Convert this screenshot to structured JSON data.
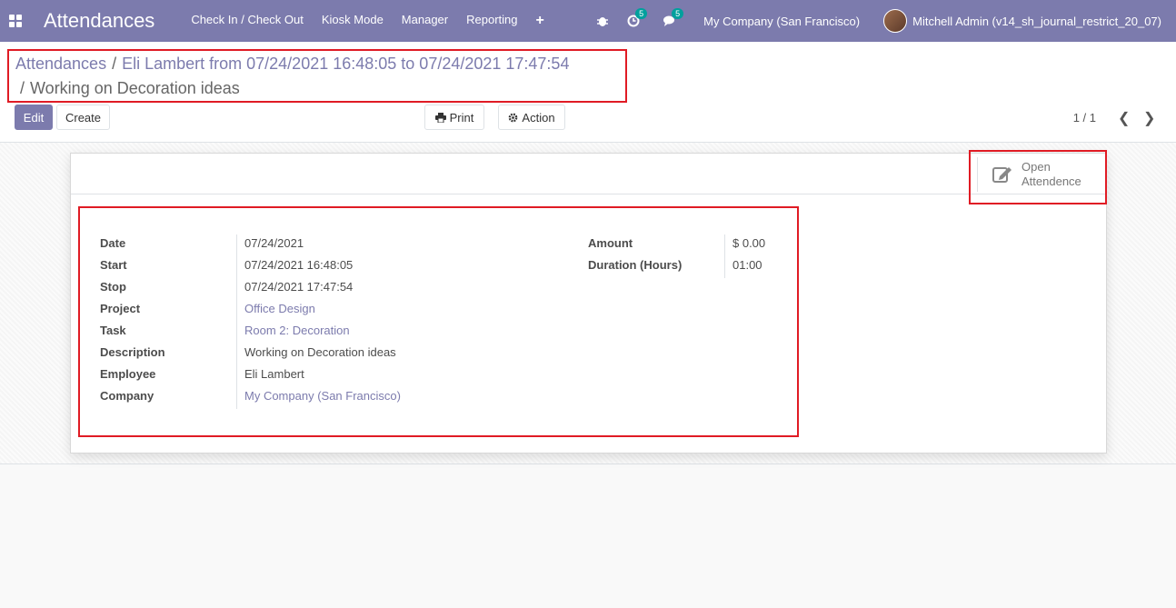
{
  "navbar": {
    "app_title": "Attendances",
    "menu": [
      "Check In / Check Out",
      "Kiosk Mode",
      "Manager",
      "Reporting"
    ],
    "activity_count": "5",
    "message_count": "5",
    "company": "My Company (San Francisco)",
    "user": "Mitchell Admin (v14_sh_journal_restrict_20_07)"
  },
  "breadcrumb": {
    "root": "Attendances",
    "parent": "Eli Lambert from 07/24/2021 16:48:05 to 07/24/2021 17:47:54",
    "current": "Working on Decoration ideas"
  },
  "toolbar": {
    "edit_label": "Edit",
    "create_label": "Create",
    "print_label": "Print",
    "action_label": "Action",
    "pager": "1 / 1"
  },
  "smart_button": {
    "line1": "Open",
    "line2": "Attendence"
  },
  "fields_left": [
    {
      "label": "Date",
      "value": "07/24/2021",
      "link": false
    },
    {
      "label": "Start",
      "value": "07/24/2021 16:48:05",
      "link": false
    },
    {
      "label": "Stop",
      "value": "07/24/2021 17:47:54",
      "link": false
    },
    {
      "label": "Project",
      "value": "Office Design",
      "link": true
    },
    {
      "label": "Task",
      "value": "Room 2: Decoration",
      "link": true
    },
    {
      "label": "Description",
      "value": "Working on Decoration ideas",
      "link": false
    },
    {
      "label": "Employee",
      "value": "Eli Lambert",
      "link": false
    },
    {
      "label": "Company",
      "value": "My Company (San Francisco)",
      "link": true
    }
  ],
  "fields_right": [
    {
      "label": "Amount",
      "value": "$ 0.00"
    },
    {
      "label": "Duration (Hours)",
      "value": "01:00"
    }
  ],
  "colors": {
    "brand": "#7c7bad",
    "highlight": "#e01b24",
    "badge": "#00a09d"
  }
}
